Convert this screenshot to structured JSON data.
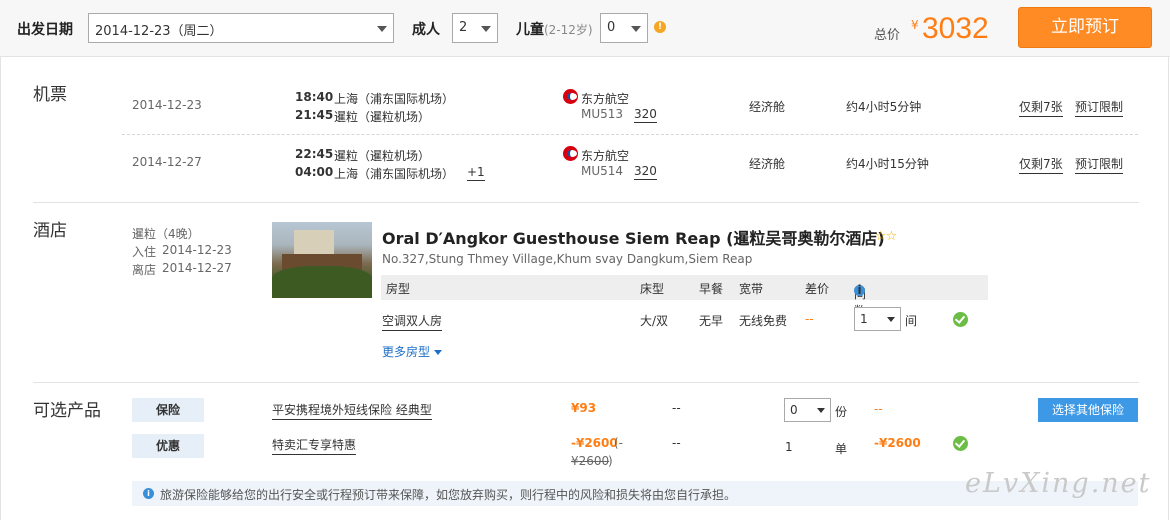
{
  "topbar": {
    "depart_label": "出发日期",
    "depart_value": "2014-12-23（周二）",
    "adult_label": "成人",
    "adult_value": "2",
    "child_label": "儿童",
    "child_sub": "(2-12岁)",
    "child_value": "0",
    "total_label": "总价",
    "currency": "¥",
    "total_price": "3032",
    "book_button": "立即预订"
  },
  "flights": {
    "section_title": "机票",
    "rows": [
      {
        "date": "2014-12-23",
        "dep_time": "18:40",
        "dep_place": "上海（浦东国际机场）",
        "arr_time": "21:45",
        "arr_place": "暹粒（暹粒机场）",
        "next_day": "",
        "airline": "东方航空",
        "flight_no": "MU513",
        "aircraft": "320",
        "cabin": "经济舱",
        "duration": "约4小时5分钟",
        "seats_left": "仅剩7张",
        "restriction": "预订限制"
      },
      {
        "date": "2014-12-27",
        "dep_time": "22:45",
        "dep_place": "暹粒（暹粒机场）",
        "arr_time": "04:00",
        "arr_place": "上海（浦东国际机场）",
        "next_day": "+1",
        "airline": "东方航空",
        "flight_no": "MU514",
        "aircraft": "320",
        "cabin": "经济舱",
        "duration": "约4小时15分钟",
        "seats_left": "仅剩7张",
        "restriction": "预订限制"
      }
    ]
  },
  "hotel": {
    "section_title": "酒店",
    "city_nights": "暹粒（4晚）",
    "checkin_label": "入住",
    "checkin_date": "2014-12-23",
    "checkout_label": "离店",
    "checkout_date": "2014-12-27",
    "name": "Oral D′Angkor Guesthouse Siem Reap (暹粒吴哥奥勒尔酒店)",
    "stars": "☆☆",
    "star_rating": 2,
    "address": "No.327,Stung Thmey Village,Khum svay Dangkum,Siem Reap",
    "room_headers": {
      "room_type": "房型",
      "bed": "床型",
      "breakfast": "早餐",
      "broadband": "宽带",
      "price_diff": "差价",
      "rooms": "间数"
    },
    "room": {
      "room_type": "空调双人房",
      "bed": "大/双",
      "breakfast": "无早",
      "broadband": "无线免费",
      "price_diff": "--",
      "rooms_value": "1",
      "rooms_unit": "间"
    },
    "more_rooms": "更多房型"
  },
  "optional": {
    "section_title": "可选产品",
    "insurance": {
      "tag": "保险",
      "name": "平安携程境外短线保险 经典型",
      "price": "¥93",
      "col2": "--",
      "qty_value": "0",
      "qty_unit": "份",
      "diff": "--",
      "button": "选择其他保险"
    },
    "promo": {
      "tag": "优惠",
      "name": "特卖汇专享特惠",
      "price": "-¥2600",
      "orig_open": "(-",
      "orig_price": "¥2600",
      "orig_close": ")",
      "col2": "--",
      "qty": "1",
      "unit": "单",
      "diff": "-¥2600"
    },
    "notice": "旅游保险能够给您的出行安全或行程预订带来保障，如您放弃购买，则行程中的风险和损失将由您自行承担。"
  },
  "watermark": "eLvXing.net",
  "colors": {
    "accent_orange": "#ff7d13",
    "button_orange": "#ff8b25",
    "button_blue": "#3d98e6",
    "success_green": "#6cbd45"
  }
}
